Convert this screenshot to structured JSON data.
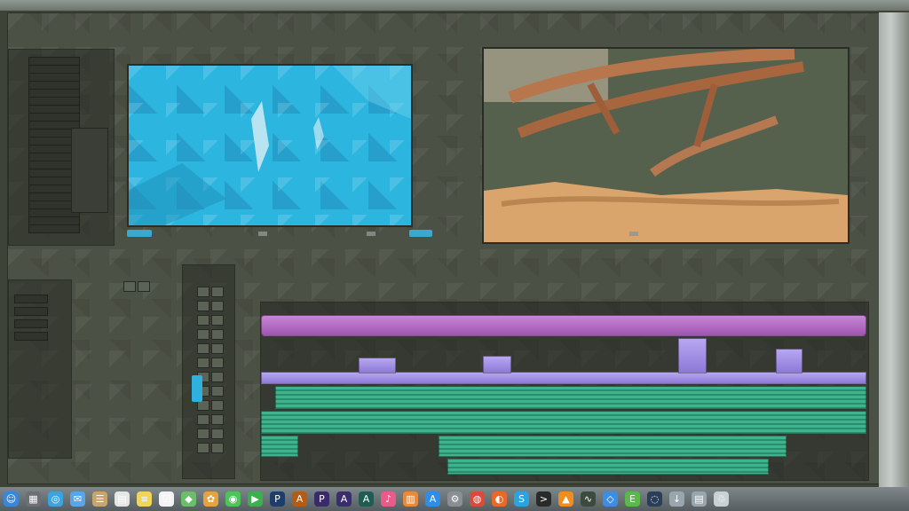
{
  "app": {
    "accent": "#2bb5df",
    "bg": "#4c5145"
  },
  "project_panel": {
    "rows": 22
  },
  "viewers": {
    "source": {
      "frame_color": "#2bb5df",
      "timecode": ""
    },
    "program": {
      "subject": "tree-branch-scene"
    }
  },
  "tools": {
    "header": "",
    "buttons": 24
  },
  "timeline": {
    "colors": {
      "video_top": "#c886d4",
      "video_mid": "#9d86e6",
      "audio": "#3fb38d"
    }
  },
  "dock": {
    "icons": [
      {
        "name": "finder-icon",
        "color": "#3a86d8",
        "glyph": "☺"
      },
      {
        "name": "launchpad-icon",
        "color": "#6d6f74",
        "glyph": "▦"
      },
      {
        "name": "safari-icon",
        "color": "#3da3e0",
        "glyph": "◎"
      },
      {
        "name": "mail-icon",
        "color": "#5aa5e8",
        "glyph": "✉"
      },
      {
        "name": "contacts-icon",
        "color": "#c9a56b",
        "glyph": "☰"
      },
      {
        "name": "calendar-icon",
        "color": "#e6e6e6",
        "glyph": "▤"
      },
      {
        "name": "notes-icon",
        "color": "#f2d45c",
        "glyph": "≡"
      },
      {
        "name": "reminders-icon",
        "color": "#f4f4f4",
        "glyph": "☑"
      },
      {
        "name": "maps-icon",
        "color": "#6cbf6a",
        "glyph": "◆"
      },
      {
        "name": "photos-icon",
        "color": "#e7a13d",
        "glyph": "✿"
      },
      {
        "name": "messages-icon",
        "color": "#4fc35b",
        "glyph": "◉"
      },
      {
        "name": "facetime-icon",
        "color": "#3bb04e",
        "glyph": "▶"
      },
      {
        "name": "photoshop-icon",
        "color": "#1d3d6b",
        "glyph": "P"
      },
      {
        "name": "illustrator-icon",
        "color": "#b25c16",
        "glyph": "A"
      },
      {
        "name": "premiere-icon",
        "color": "#3a2a6b",
        "glyph": "P"
      },
      {
        "name": "after-effects-icon",
        "color": "#3a2d6d",
        "glyph": "A"
      },
      {
        "name": "audition-icon",
        "color": "#1f5c54",
        "glyph": "A"
      },
      {
        "name": "itunes-icon",
        "color": "#e85c8a",
        "glyph": "♪"
      },
      {
        "name": "ibooks-icon",
        "color": "#e9893a",
        "glyph": "▥"
      },
      {
        "name": "app-store-icon",
        "color": "#2e8ee6",
        "glyph": "A"
      },
      {
        "name": "preferences-icon",
        "color": "#8a8f94",
        "glyph": "⚙"
      },
      {
        "name": "chrome-icon",
        "color": "#d94b3b",
        "glyph": "◍"
      },
      {
        "name": "firefox-icon",
        "color": "#e66a2a",
        "glyph": "◐"
      },
      {
        "name": "skype-icon",
        "color": "#2aa3e0",
        "glyph": "S"
      },
      {
        "name": "terminal-icon",
        "color": "#2a2a2a",
        "glyph": ">"
      },
      {
        "name": "vlc-icon",
        "color": "#f28c1e",
        "glyph": "▲"
      },
      {
        "name": "activity-monitor-icon",
        "color": "#3d4b3e",
        "glyph": "∿"
      },
      {
        "name": "dropbox-icon",
        "color": "#3b8ee6",
        "glyph": "◇"
      },
      {
        "name": "evernote-icon",
        "color": "#5bb84b",
        "glyph": "E"
      },
      {
        "name": "steam-icon",
        "color": "#2a3f57",
        "glyph": "◌"
      },
      {
        "name": "downloads-icon",
        "color": "#9aa6ad",
        "glyph": "↓"
      },
      {
        "name": "documents-icon",
        "color": "#9aa6ad",
        "glyph": "▤"
      },
      {
        "name": "trash-icon",
        "color": "#c9d1d5",
        "glyph": "♲"
      }
    ]
  }
}
